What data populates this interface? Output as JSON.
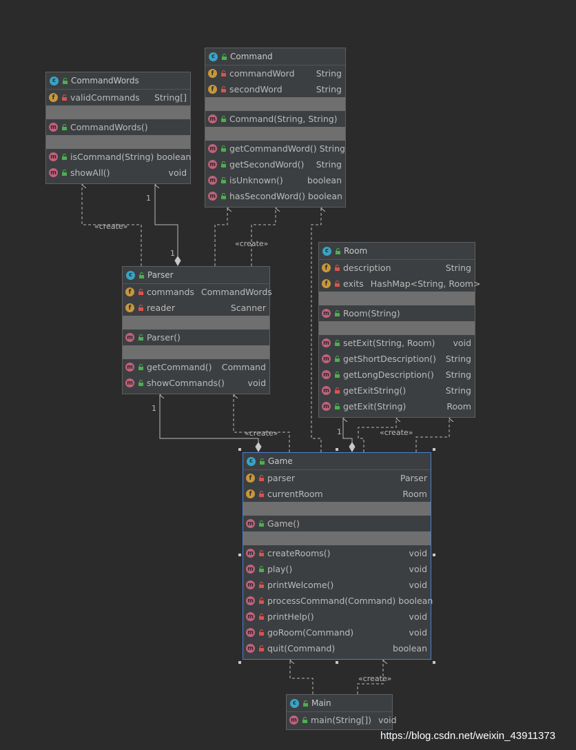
{
  "classes": {
    "command_words": {
      "name": "CommandWords",
      "fields": [
        {
          "name": "validCommands",
          "type": "String[]"
        }
      ],
      "constructors": [
        {
          "name": "CommandWords()",
          "type": ""
        }
      ],
      "methods": [
        {
          "name": "isCommand(String)",
          "type": "boolean"
        },
        {
          "name": "showAll()",
          "type": "void"
        }
      ]
    },
    "command": {
      "name": "Command",
      "fields": [
        {
          "name": "commandWord",
          "type": "String"
        },
        {
          "name": "secondWord",
          "type": "String"
        }
      ],
      "constructors": [
        {
          "name": "Command(String, String)",
          "type": ""
        }
      ],
      "methods": [
        {
          "name": "getCommandWord()",
          "type": "String"
        },
        {
          "name": "getSecondWord()",
          "type": "String"
        },
        {
          "name": "isUnknown()",
          "type": "boolean"
        },
        {
          "name": "hasSecondWord()",
          "type": "boolean"
        }
      ]
    },
    "room": {
      "name": "Room",
      "fields": [
        {
          "name": "description",
          "type": "String"
        },
        {
          "name": "exits",
          "type": "HashMap<String, Room>"
        }
      ],
      "constructors": [
        {
          "name": "Room(String)",
          "type": ""
        }
      ],
      "methods": [
        {
          "name": "setExit(String, Room)",
          "type": "void"
        },
        {
          "name": "getShortDescription()",
          "type": "String"
        },
        {
          "name": "getLongDescription()",
          "type": "String"
        },
        {
          "name": "getExitString()",
          "type": "String"
        },
        {
          "name": "getExit(String)",
          "type": "Room"
        }
      ]
    },
    "parser": {
      "name": "Parser",
      "fields": [
        {
          "name": "commands",
          "type": "CommandWords"
        },
        {
          "name": "reader",
          "type": "Scanner"
        }
      ],
      "constructors": [
        {
          "name": "Parser()",
          "type": ""
        }
      ],
      "methods": [
        {
          "name": "getCommand()",
          "type": "Command"
        },
        {
          "name": "showCommands()",
          "type": "void"
        }
      ]
    },
    "game": {
      "name": "Game",
      "fields": [
        {
          "name": "parser",
          "type": "Parser"
        },
        {
          "name": "currentRoom",
          "type": "Room"
        }
      ],
      "constructors": [
        {
          "name": "Game()",
          "type": ""
        }
      ],
      "methods": [
        {
          "name": "createRooms()",
          "type": "void"
        },
        {
          "name": "play()",
          "type": "void"
        },
        {
          "name": "printWelcome()",
          "type": "void"
        },
        {
          "name": "processCommand(Command)",
          "type": "boolean"
        },
        {
          "name": "printHelp()",
          "type": "void"
        },
        {
          "name": "goRoom(Command)",
          "type": "void"
        },
        {
          "name": "quit(Command)",
          "type": "boolean"
        }
      ]
    },
    "main": {
      "name": "Main",
      "methods": [
        {
          "name": "main(String[])",
          "type": "void"
        }
      ]
    }
  },
  "edge_labels": {
    "create": "«create»",
    "one": "1"
  },
  "icons": {
    "class": "c",
    "field": "f",
    "method": "m"
  },
  "colors": {
    "background": "#2b2b2b",
    "box": "#3c3f41",
    "class_icon": "#3aa3c4",
    "field_icon": "#c8973a",
    "method_icon": "#c2617b",
    "public": "#4caf50",
    "private": "#d9534f",
    "selection": "#4b7fd1"
  },
  "watermark": "https://blog.csdn.net/weixin_43911373"
}
